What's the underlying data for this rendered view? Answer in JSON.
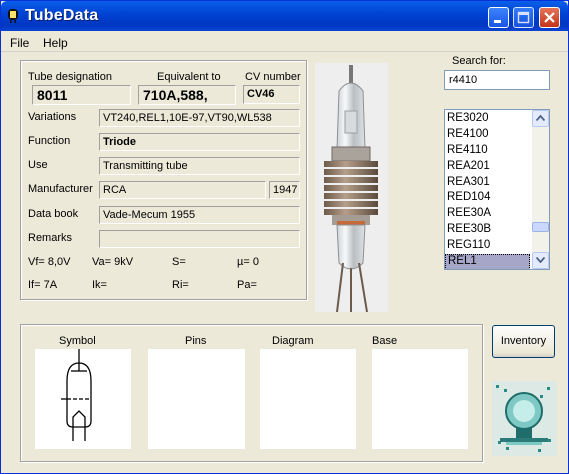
{
  "window": {
    "title": "TubeData"
  },
  "menu": {
    "file": "File",
    "help": "Help"
  },
  "tube": {
    "designation_label": "Tube designation",
    "designation": "8011",
    "equivalent_label": "Equivalent to",
    "equivalent": "710A,588,",
    "cv_label": "CV number",
    "cv": "CV46",
    "variations_label": "Variations",
    "variations": "VT240,REL1,10E-97,VT90,WL538",
    "function_label": "Function",
    "function": "Triode",
    "use_label": "Use",
    "use": "Transmitting tube",
    "manufacturer_label": "Manufacturer",
    "manufacturer": "RCA",
    "year": "1947",
    "databook_label": "Data book",
    "databook": "Vade-Mecum 1955",
    "remarks_label": "Remarks",
    "remarks": "",
    "params_row1": [
      "Vf= 8,0V",
      "Va= 9kV",
      "S=",
      "µ=   0"
    ],
    "params_row2": [
      "If= 7A",
      "Ik=",
      "Ri=",
      "Pa="
    ]
  },
  "search": {
    "label": "Search for:",
    "value": "r4410"
  },
  "tube_list": {
    "items": [
      "RE3020",
      "RE4100",
      "RE4110",
      "REA201",
      "REA301",
      "RED104",
      "REE30A",
      "REE30B",
      "REG110",
      "REL1"
    ],
    "selected": "REL1"
  },
  "panels": {
    "symbol": "Symbol",
    "pins": "Pins",
    "diagram": "Diagram",
    "base": "Base"
  },
  "buttons": {
    "inventory": "Inventory"
  },
  "icons": {
    "app": "tube-icon",
    "minimize": "minimize-icon",
    "maximize": "maximize-icon",
    "close": "close-icon",
    "scroll_up": "scroll-up-arrow-icon",
    "scroll_down": "scroll-down-arrow-icon"
  }
}
